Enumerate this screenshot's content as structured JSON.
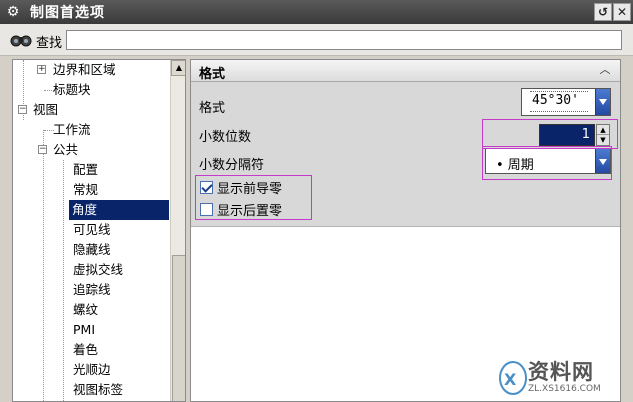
{
  "window": {
    "title": "制图首选项",
    "reset_glyph": "↺",
    "close_glyph": "✕"
  },
  "search": {
    "label": "查找",
    "value": "",
    "placeholder": ""
  },
  "tree": {
    "items": [
      {
        "label": "边界和区域",
        "expander": "+"
      },
      {
        "label": "标题块"
      },
      {
        "label": "视图",
        "expander": "−"
      },
      {
        "label": "工作流"
      },
      {
        "label": "公共",
        "expander": "−"
      },
      {
        "label": "配置"
      },
      {
        "label": "常规"
      },
      {
        "label": "角度",
        "selected": true
      },
      {
        "label": "可见线"
      },
      {
        "label": "隐藏线"
      },
      {
        "label": "虚拟交线"
      },
      {
        "label": "追踪线"
      },
      {
        "label": "螺纹"
      },
      {
        "label": "PMI"
      },
      {
        "label": "着色"
      },
      {
        "label": "光顺边"
      },
      {
        "label": "视图标签"
      }
    ]
  },
  "section": {
    "title": "格式",
    "format": {
      "label": "格式",
      "value": "45°30'"
    },
    "decimals": {
      "label": "小数位数",
      "value": "1"
    },
    "separator": {
      "label": "小数分隔符",
      "value": "• 周期"
    },
    "show_leading_zeros": {
      "label": "显示前导零",
      "checked": true
    },
    "show_trailing_zeros": {
      "label": "显示后置零",
      "checked": false
    }
  },
  "watermark": {
    "text": "资料网",
    "url": "ZL.XS1616.COM"
  },
  "colors": {
    "selection": "#0a246a",
    "highlight": "#c33bc8",
    "dropdown": "#2449a3"
  }
}
